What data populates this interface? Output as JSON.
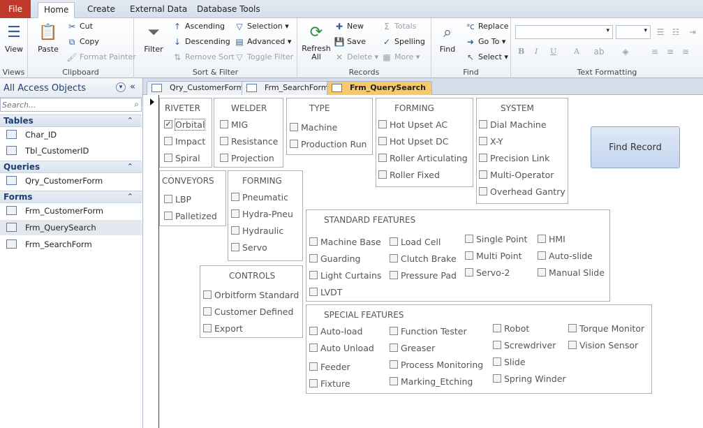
{
  "ribbon_tabs": {
    "file": "File",
    "home": "Home",
    "create": "Create",
    "external": "External Data",
    "dbtools": "Database Tools"
  },
  "ribbon": {
    "views": {
      "view": "View",
      "label": "Views"
    },
    "clipboard": {
      "paste": "Paste",
      "cut": "Cut",
      "copy": "Copy",
      "painter": "Format Painter",
      "label": "Clipboard"
    },
    "sort": {
      "filter": "Filter",
      "ascending": "Ascending",
      "descending": "Descending",
      "remove_sort": "Remove Sort",
      "selection": "Selection",
      "advanced": "Advanced",
      "toggle": "Toggle Filter",
      "label": "Sort & Filter"
    },
    "records": {
      "refresh": "Refresh All",
      "new": "New",
      "save": "Save",
      "delete": "Delete",
      "totals": "Totals",
      "spelling": "Spelling",
      "more": "More",
      "label": "Records"
    },
    "find": {
      "find": "Find",
      "replace": "Replace",
      "goto": "Go To",
      "select": "Select",
      "label": "Find"
    },
    "text": {
      "label": "Text Formatting",
      "bold": "B",
      "italic": "I",
      "underline": "U",
      "fontcolor": "A"
    }
  },
  "nav": {
    "title": "All Access Objects",
    "search_placeholder": "Search...",
    "cat_tables": "Tables",
    "tables": [
      "Char_ID",
      "Tbl_CustomerID"
    ],
    "cat_queries": "Queries",
    "queries": [
      "Qry_CustomerForm"
    ],
    "cat_forms": "Forms",
    "forms": [
      "Frm_CustomerForm",
      "Frm_QuerySearch",
      "Frm_SearchForm"
    ]
  },
  "doc_tabs": [
    "Qry_CustomerForm",
    "Frm_SearchForm",
    "Frm_QuerySearch"
  ],
  "form": {
    "riveter": {
      "title": "RIVETER",
      "items": [
        "Orbital",
        "Impact",
        "Spiral"
      ],
      "checked": [
        true,
        false,
        false
      ]
    },
    "welder": {
      "title": "WELDER",
      "items": [
        "MIG",
        "Resistance",
        "Projection"
      ]
    },
    "type": {
      "title": "TYPE",
      "items": [
        "Machine",
        "Production Run"
      ]
    },
    "forming1": {
      "title": "FORMING",
      "items": [
        "Hot Upset AC",
        "Hot Upset DC",
        "Roller Articulating",
        "Roller Fixed"
      ]
    },
    "system": {
      "title": "SYSTEM",
      "items": [
        "Dial Machine",
        "X-Y",
        "Precision Link",
        "Multi-Operator",
        "Overhead Gantry"
      ]
    },
    "conveyors": {
      "title": "CONVEYORS",
      "items": [
        "LBP",
        "Palletized"
      ]
    },
    "forming2": {
      "title": "FORMING",
      "items": [
        "Pneumatic",
        "Hydra-Pneu",
        "Hydraulic",
        "Servo"
      ]
    },
    "controls": {
      "title": "CONTROLS",
      "items": [
        "Orbitform Standard",
        "Customer Defined",
        "Export"
      ]
    },
    "standard": {
      "title": "STANDARD FEATURES",
      "items": [
        "Machine Base",
        "Guarding",
        "Light Curtains",
        "LVDT",
        "Load Cell",
        "Clutch Brake",
        "Pressure Pad",
        "Single Point",
        "Multi Point",
        "Servo-2",
        "HMI",
        "Auto-slide",
        "Manual Slide"
      ]
    },
    "special": {
      "title": "SPECIAL FEATURES",
      "items": [
        "Auto-load",
        "Auto Unload",
        "Feeder",
        "Fixture",
        "Function Tester",
        "Greaser",
        "Process Monitoring",
        "Marking_Etching",
        "Robot",
        "Screwdriver",
        "Slide",
        "Spring Winder",
        "Torque Monitor",
        "Vision Sensor"
      ]
    },
    "find_button": "Find Record"
  }
}
